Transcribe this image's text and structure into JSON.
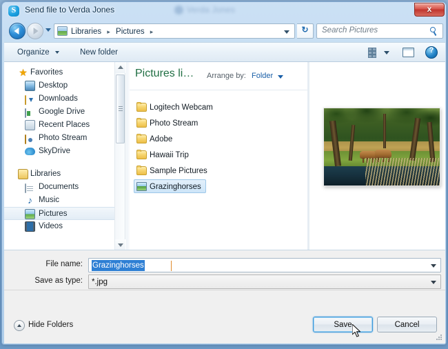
{
  "window": {
    "title": "Send file to Verda Jones",
    "app_icon": "skype-icon",
    "app_icon_letter": "S",
    "close_label": "x",
    "ghost_title": "Verda Jones"
  },
  "nav": {
    "back_tooltip": "Back",
    "forward_tooltip": "Forward",
    "breadcrumbs": [
      "Libraries",
      "Pictures"
    ],
    "breadcrumb_separator": "▸",
    "refresh_label": "↻",
    "search_placeholder": "Search Pictures"
  },
  "toolbar": {
    "organize_label": "Organize",
    "new_folder_label": "New folder",
    "view_icon": "view-list-icon",
    "preview_pane_icon": "preview-pane-icon",
    "help_icon": "help-icon",
    "help_label": "?"
  },
  "sidebar": {
    "groups": [
      {
        "header": {
          "label": "Favorites",
          "icon": "star-icon"
        },
        "items": [
          {
            "label": "Desktop",
            "icon": "desktop-icon"
          },
          {
            "label": "Downloads",
            "icon": "downloads-icon"
          },
          {
            "label": "Google Drive",
            "icon": "google-drive-icon"
          },
          {
            "label": "Recent Places",
            "icon": "recent-places-icon"
          },
          {
            "label": "Photo Stream",
            "icon": "photo-stream-icon"
          },
          {
            "label": "SkyDrive",
            "icon": "skydrive-icon"
          }
        ]
      },
      {
        "header": {
          "label": "Libraries",
          "icon": "libraries-icon"
        },
        "items": [
          {
            "label": "Documents",
            "icon": "documents-icon"
          },
          {
            "label": "Music",
            "icon": "music-icon"
          },
          {
            "label": "Pictures",
            "icon": "pictures-icon",
            "selected": true
          },
          {
            "label": "Videos",
            "icon": "videos-icon"
          }
        ]
      }
    ]
  },
  "file_list": {
    "library_title": "Pictures li…",
    "arrange_by_label": "Arrange by:",
    "arrange_by_value": "Folder",
    "items": [
      {
        "name": "Logitech Webcam",
        "type": "folder"
      },
      {
        "name": "Photo Stream",
        "type": "folder"
      },
      {
        "name": "Adobe",
        "type": "folder"
      },
      {
        "name": "Hawaii Trip",
        "type": "folder"
      },
      {
        "name": "Sample Pictures",
        "type": "folder"
      },
      {
        "name": "Grazinghorses",
        "type": "image",
        "selected": true
      }
    ]
  },
  "preview": {
    "image_alt": "Two horses grazing beside a pond with willow trees"
  },
  "form": {
    "file_name_label": "File name:",
    "file_name_value": "Grazinghorses",
    "save_as_type_label": "Save as type:",
    "save_as_type_value": "*.jpg"
  },
  "footer": {
    "hide_folders_label": "Hide Folders",
    "save_label": "Save",
    "cancel_label": "Cancel"
  },
  "colors": {
    "accent_blue": "#2e7fd4",
    "library_green": "#1f6e42",
    "close_red": "#c0352d",
    "focus_blue": "#3d98d9"
  }
}
